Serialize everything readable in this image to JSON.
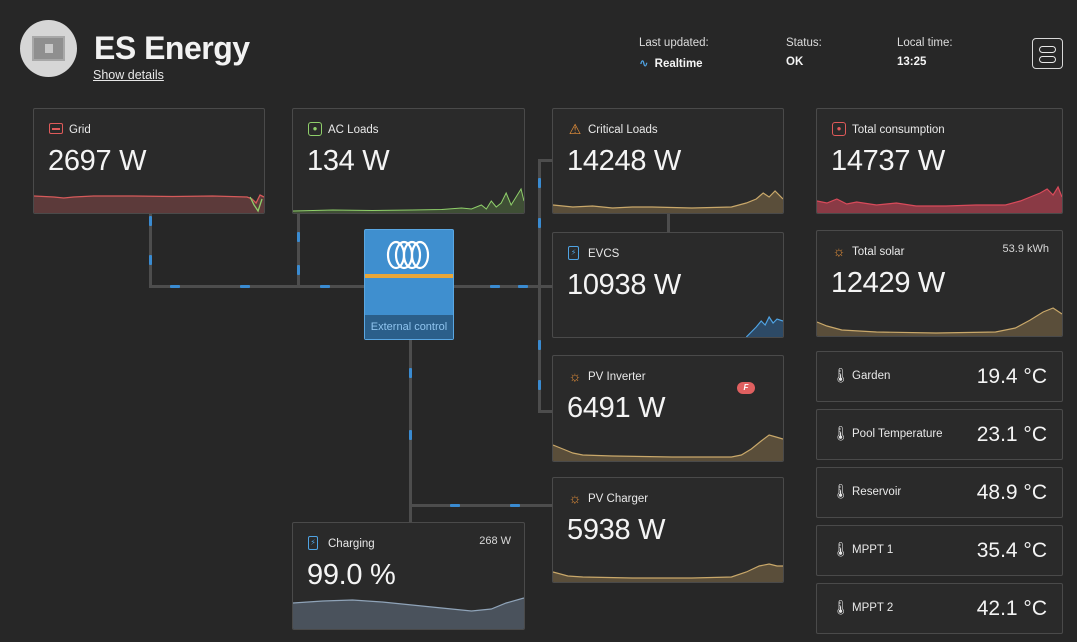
{
  "header": {
    "title": "ES Energy",
    "show_details": "Show details",
    "last_updated_label": "Last updated:",
    "last_updated_value": "Realtime",
    "status_label": "Status:",
    "status_value": "OK",
    "local_time_label": "Local time:",
    "local_time_value": "13:25"
  },
  "cards": {
    "grid": {
      "title": "Grid",
      "value": "2697 W"
    },
    "ac_loads": {
      "title": "AC Loads",
      "value": "134 W"
    },
    "critical_loads": {
      "title": "Critical Loads",
      "value": "14248 W"
    },
    "evcs": {
      "title": "EVCS",
      "value": "10938 W"
    },
    "pv_inverter": {
      "title": "PV Inverter",
      "value": "6491 W"
    },
    "pv_charger": {
      "title": "PV Charger",
      "value": "5938 W"
    },
    "charging": {
      "title": "Charging",
      "value": "99.0 %",
      "extra": "268 W"
    },
    "total_consumption": {
      "title": "Total consumption",
      "value": "14737 W"
    },
    "total_solar": {
      "title": "Total solar",
      "value": "12429 W",
      "extra": "53.9 kWh"
    }
  },
  "inverter": {
    "label": "External control"
  },
  "temperatures": [
    {
      "name": "Garden",
      "value": "19.4 °C"
    },
    {
      "name": "Pool Temperature",
      "value": "23.1 °C"
    },
    {
      "name": "Reservoir",
      "value": "48.9 °C"
    },
    {
      "name": "MPPT 1",
      "value": "35.4 °C"
    },
    {
      "name": "MPPT 2",
      "value": "42.1 °C"
    }
  ],
  "colors": {
    "grid": "#e05a5a",
    "ac_loads": "#8fcf6a",
    "solar": "#c9a86a",
    "evcs": "#4fa3e3",
    "battery": "#8fa3b8",
    "consumption": "#d94a5a"
  }
}
